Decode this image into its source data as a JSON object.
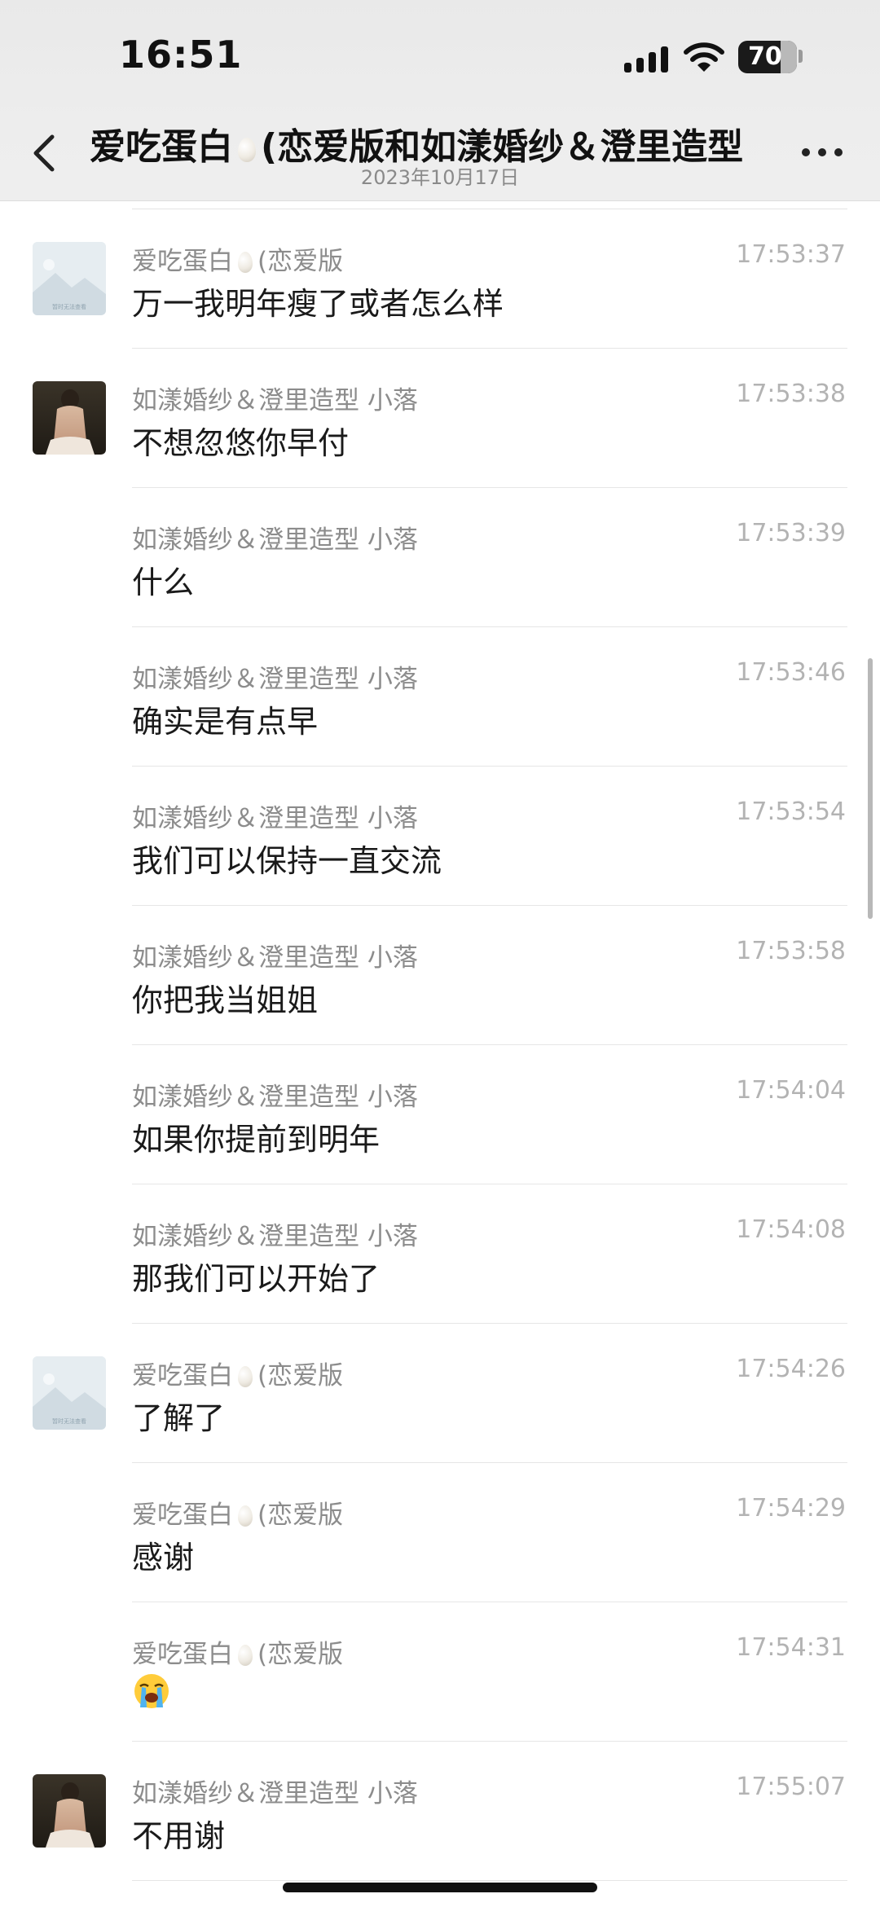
{
  "status_bar": {
    "time": "16:51",
    "battery": "70"
  },
  "header": {
    "title": "爱吃蛋白",
    "title_rest": "(恋爱版和如漾婚纱＆澄里造型",
    "date": "2023年10月17日"
  },
  "messages": [
    {
      "sender": "爱吃蛋白",
      "sender_rest": "(恋爱版",
      "time": "17:53:37",
      "text": "万一我明年瘦了或者怎么样",
      "avatar": "placeholder"
    },
    {
      "sender": "如漾婚纱＆澄里造型 小落",
      "time": "17:53:38",
      "text": "不想忽悠你早付",
      "avatar": "photo"
    },
    {
      "sender": "如漾婚纱＆澄里造型 小落",
      "time": "17:53:39",
      "text": "什么",
      "avatar": ""
    },
    {
      "sender": "如漾婚纱＆澄里造型 小落",
      "time": "17:53:46",
      "text": "确实是有点早",
      "avatar": ""
    },
    {
      "sender": "如漾婚纱＆澄里造型 小落",
      "time": "17:53:54",
      "text": "我们可以保持一直交流",
      "avatar": ""
    },
    {
      "sender": "如漾婚纱＆澄里造型 小落",
      "time": "17:53:58",
      "text": "你把我当姐姐",
      "avatar": ""
    },
    {
      "sender": "如漾婚纱＆澄里造型 小落",
      "time": "17:54:04",
      "text": "如果你提前到明年",
      "avatar": ""
    },
    {
      "sender": "如漾婚纱＆澄里造型 小落",
      "time": "17:54:08",
      "text": "那我们可以开始了",
      "avatar": ""
    },
    {
      "sender": "爱吃蛋白",
      "sender_rest": "(恋爱版",
      "time": "17:54:26",
      "text": "了解了",
      "avatar": "placeholder"
    },
    {
      "sender": "爱吃蛋白",
      "sender_rest": "(恋爱版",
      "time": "17:54:29",
      "text": "感谢",
      "avatar": ""
    },
    {
      "sender": "爱吃蛋白",
      "sender_rest": "(恋爱版",
      "time": "17:54:31",
      "text": "",
      "emoji": "loudly-crying-face-emoji",
      "avatar": ""
    },
    {
      "sender": "如漾婚纱＆澄里造型 小落",
      "time": "17:55:07",
      "text": "不用谢",
      "avatar": "photo"
    }
  ],
  "placeholder_avatar_caption": "暂时无法查看",
  "icons": {
    "back": "chevron-left-icon",
    "more": "more-dots-icon",
    "signal": "signal-icon",
    "wifi": "wifi-icon",
    "battery": "battery-icon",
    "egg": "egg-emoji"
  }
}
